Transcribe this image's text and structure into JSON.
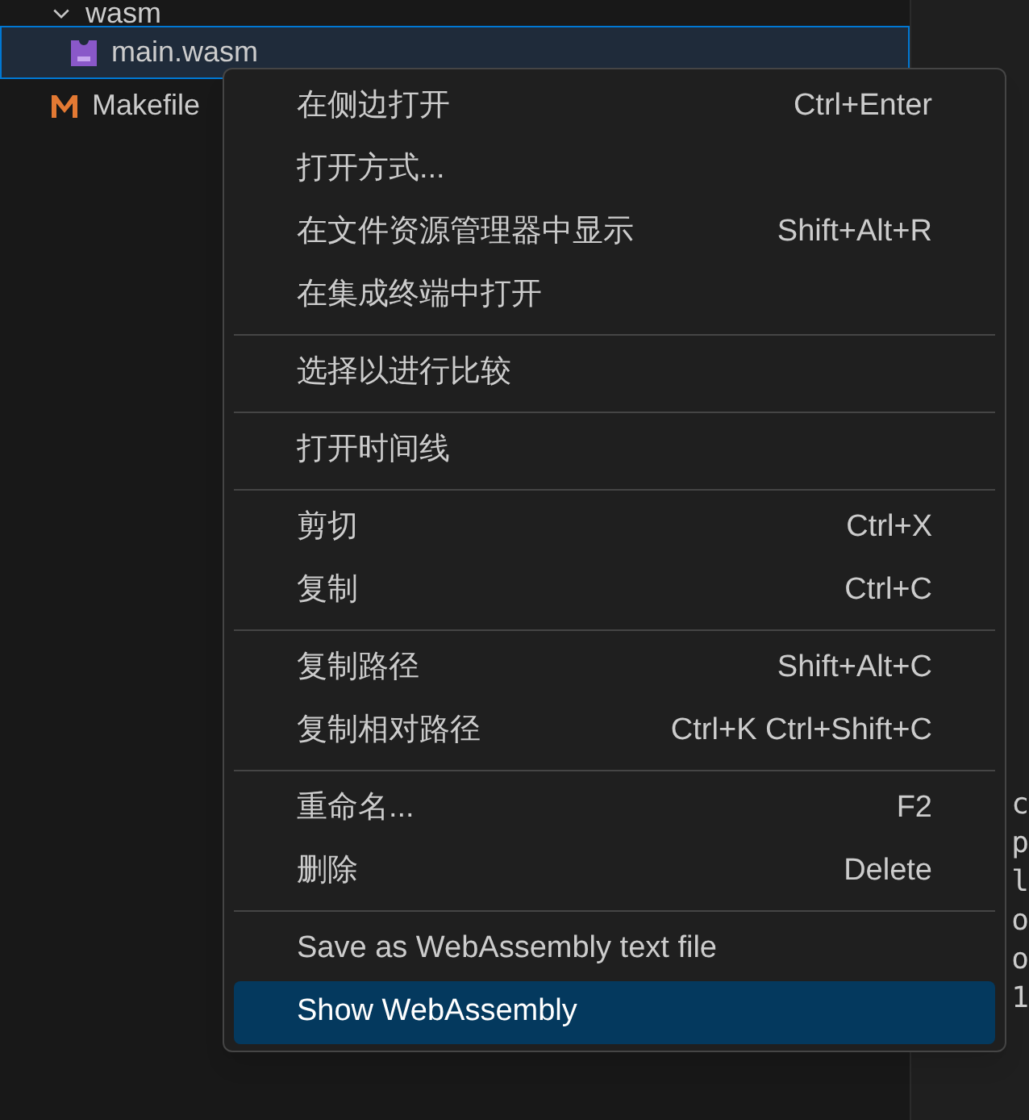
{
  "explorer": {
    "items": [
      {
        "label": "wasm",
        "kind": "folder",
        "expanded": true,
        "selected": false,
        "children": [
          {
            "label": "main.wasm",
            "kind": "wasm",
            "selected": true
          }
        ]
      },
      {
        "label": "Makefile",
        "kind": "makefile",
        "selected": false
      }
    ]
  },
  "editor": {
    "code_lines": [
      "c",
      "p",
      "l",
      "o",
      "o",
      "1"
    ]
  },
  "context_menu": {
    "groups": [
      {
        "items": [
          {
            "label": "在侧边打开",
            "shortcut": "Ctrl+Enter",
            "selected": false
          },
          {
            "label": "打开方式...",
            "selected": false
          },
          {
            "label": "在文件资源管理器中显示",
            "shortcut": "Shift+Alt+R",
            "selected": false
          },
          {
            "label": "在集成终端中打开",
            "selected": false
          }
        ]
      },
      {
        "items": [
          {
            "label": "选择以进行比较",
            "selected": false
          }
        ]
      },
      {
        "items": [
          {
            "label": "打开时间线",
            "selected": false
          }
        ]
      },
      {
        "items": [
          {
            "label": "剪切",
            "shortcut": "Ctrl+X",
            "selected": false
          },
          {
            "label": "复制",
            "shortcut": "Ctrl+C",
            "selected": false
          }
        ]
      },
      {
        "items": [
          {
            "label": "复制路径",
            "shortcut": "Shift+Alt+C",
            "selected": false
          },
          {
            "label": "复制相对路径",
            "shortcut": "Ctrl+K Ctrl+Shift+C",
            "selected": false
          }
        ]
      },
      {
        "items": [
          {
            "label": "重命名...",
            "shortcut": "F2",
            "selected": false
          },
          {
            "label": "删除",
            "shortcut": "Delete",
            "selected": false
          }
        ]
      },
      {
        "items": [
          {
            "label": "Save as WebAssembly text file",
            "selected": false
          },
          {
            "label": "Show WebAssembly",
            "selected": true
          }
        ]
      }
    ]
  }
}
